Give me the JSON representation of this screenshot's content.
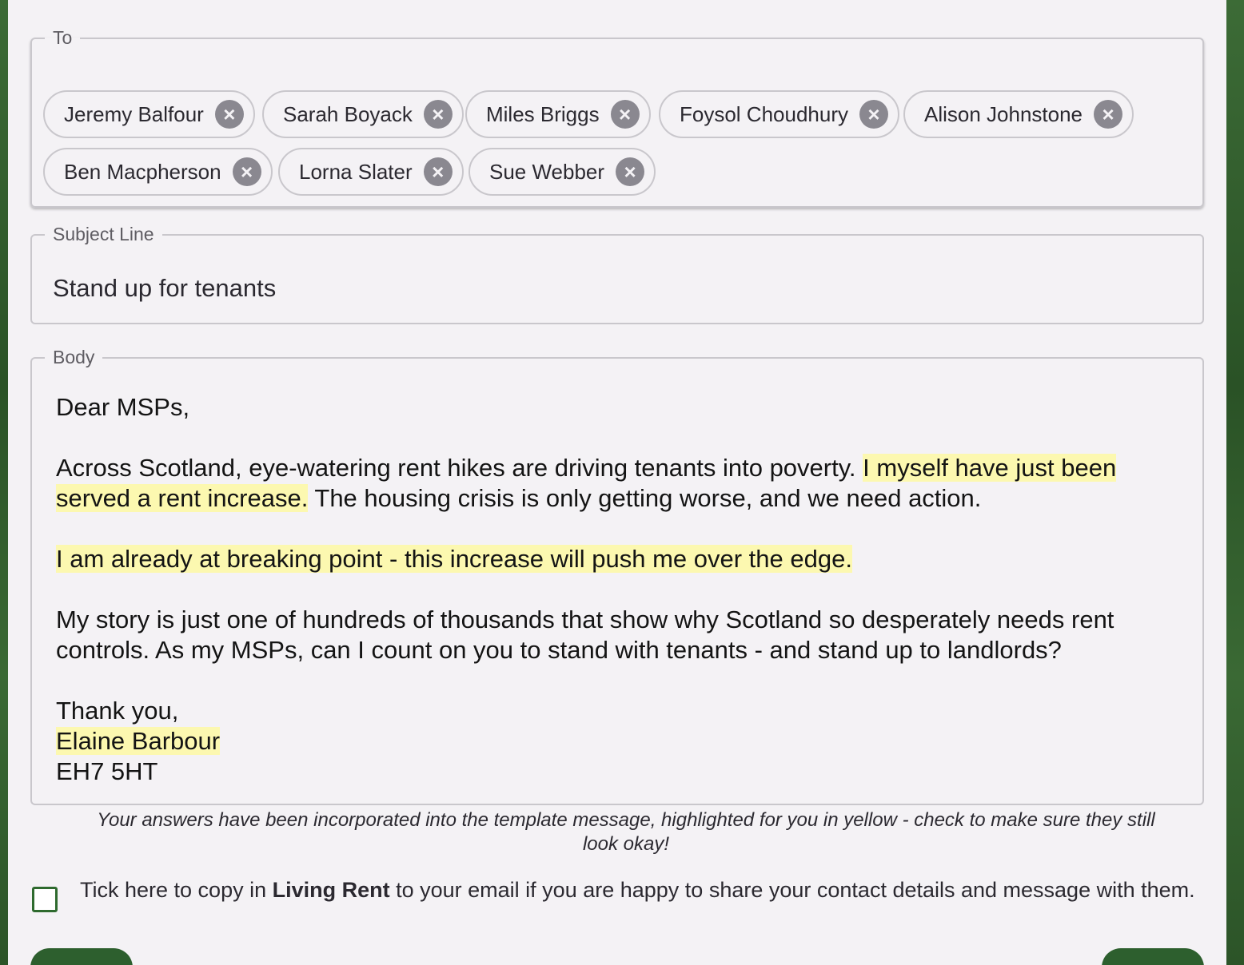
{
  "to": {
    "legend": "To",
    "recipients": [
      "Jeremy Balfour",
      "Sarah Boyack",
      "Miles Briggs",
      "Foysol Choudhury",
      "Alison Johnstone",
      "Ben Macpherson",
      "Lorna Slater",
      "Sue Webber"
    ]
  },
  "subject": {
    "legend": "Subject Line",
    "value": "Stand up for tenants"
  },
  "body": {
    "legend": "Body",
    "greeting": "Dear MSPs,",
    "p1_a": "Across Scotland, eye-watering rent hikes are driving tenants into poverty. ",
    "p1_highlight": "I myself have just been served a rent increase.",
    "p1_b": " The housing crisis is only getting worse, and we need action.",
    "p2_highlight": "I am already at breaking point - this increase will push me over the edge.",
    "p3": "My story is just one of hundreds of thousands that show why Scotland so desperately needs rent controls. As my MSPs, can I count on you to stand with tenants - and stand up to landlords?",
    "signoff": "Thank you,",
    "name_highlight": "Elaine Barbour",
    "postcode": "EH7 5HT"
  },
  "hint": "Your answers have been incorporated into the template message, highlighted for you in yellow - check to make sure they still look okay!",
  "consent": {
    "checked": false,
    "text_a": "Tick here to copy in ",
    "org": "Living Rent",
    "text_b": " to your email if you are happy to share your contact details and message with them."
  },
  "colors": {
    "highlight": "#fcf8b0",
    "accent": "#2d5f2e",
    "background": "#2f5a2c"
  }
}
